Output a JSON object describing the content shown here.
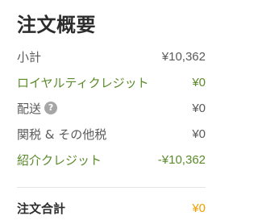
{
  "summary": {
    "title": "注文概要",
    "rows": [
      {
        "label": "小計",
        "value": "¥10,362"
      },
      {
        "label": "ロイヤルティクレジット",
        "value": "¥0"
      },
      {
        "label": "配送",
        "value": "¥0",
        "help_icon": "?"
      },
      {
        "label": "関税 & その他税",
        "value": "¥0"
      },
      {
        "label": "紹介クレジット",
        "value": "-¥10,362"
      }
    ],
    "total": {
      "label": "注文合計",
      "value": "¥0"
    }
  },
  "colors": {
    "credit_green": "#5b8a2b",
    "total_orange": "#f0a000",
    "help_icon_gray": "#a6a6a6"
  },
  "icons": {
    "shipping_help": "question-circle-icon"
  }
}
